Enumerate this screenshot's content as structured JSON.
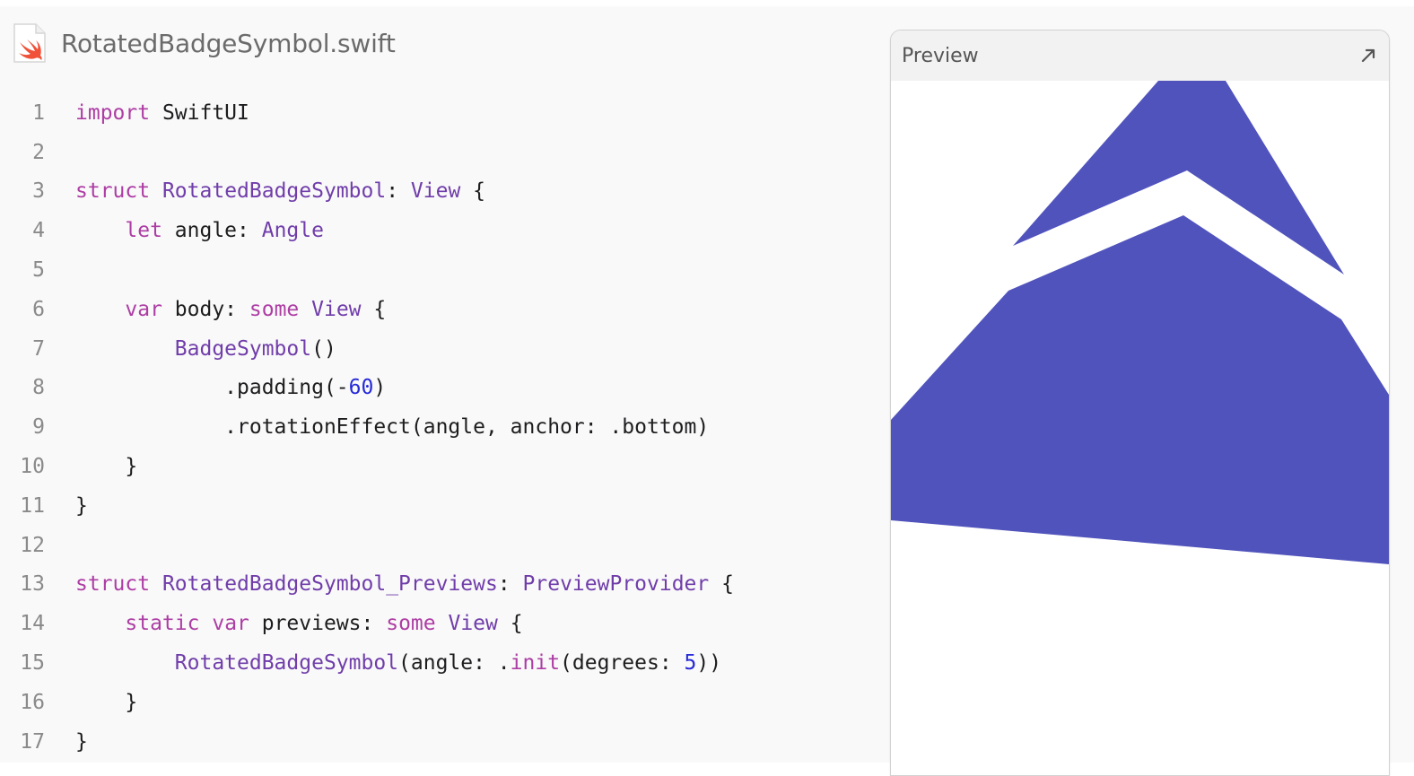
{
  "file": {
    "icon": "swift-file-icon",
    "title": "RotatedBadgeSymbol.swift"
  },
  "code": {
    "lines": [
      {
        "n": "1",
        "tokens": [
          {
            "t": "import",
            "c": "kw"
          },
          {
            "t": " SwiftUI",
            "c": "src"
          }
        ]
      },
      {
        "n": "2",
        "tokens": []
      },
      {
        "n": "3",
        "tokens": [
          {
            "t": "struct",
            "c": "kw"
          },
          {
            "t": " ",
            "c": "src"
          },
          {
            "t": "RotatedBadgeSymbol",
            "c": "ty"
          },
          {
            "t": ": ",
            "c": "src"
          },
          {
            "t": "View",
            "c": "ty"
          },
          {
            "t": " {",
            "c": "src"
          }
        ]
      },
      {
        "n": "4",
        "tokens": [
          {
            "t": "    ",
            "c": "src"
          },
          {
            "t": "let",
            "c": "kw"
          },
          {
            "t": " angle: ",
            "c": "src"
          },
          {
            "t": "Angle",
            "c": "ty"
          }
        ]
      },
      {
        "n": "5",
        "tokens": []
      },
      {
        "n": "6",
        "tokens": [
          {
            "t": "    ",
            "c": "src"
          },
          {
            "t": "var",
            "c": "kw"
          },
          {
            "t": " body: ",
            "c": "src"
          },
          {
            "t": "some",
            "c": "kw"
          },
          {
            "t": " ",
            "c": "src"
          },
          {
            "t": "View",
            "c": "ty"
          },
          {
            "t": " {",
            "c": "src"
          }
        ]
      },
      {
        "n": "7",
        "tokens": [
          {
            "t": "        ",
            "c": "src"
          },
          {
            "t": "BadgeSymbol",
            "c": "ty"
          },
          {
            "t": "()",
            "c": "src"
          }
        ]
      },
      {
        "n": "8",
        "tokens": [
          {
            "t": "            .padding(-",
            "c": "src"
          },
          {
            "t": "60",
            "c": "num"
          },
          {
            "t": ")",
            "c": "src"
          }
        ]
      },
      {
        "n": "9",
        "tokens": [
          {
            "t": "            .rotationEffect(angle, anchor: .bottom)",
            "c": "src"
          }
        ]
      },
      {
        "n": "10",
        "tokens": [
          {
            "t": "    }",
            "c": "src"
          }
        ]
      },
      {
        "n": "11",
        "tokens": [
          {
            "t": "}",
            "c": "src"
          }
        ]
      },
      {
        "n": "12",
        "tokens": []
      },
      {
        "n": "13",
        "tokens": [
          {
            "t": "struct",
            "c": "kw"
          },
          {
            "t": " ",
            "c": "src"
          },
          {
            "t": "RotatedBadgeSymbol_Previews",
            "c": "ty"
          },
          {
            "t": ": ",
            "c": "src"
          },
          {
            "t": "PreviewProvider",
            "c": "ty"
          },
          {
            "t": " {",
            "c": "src"
          }
        ]
      },
      {
        "n": "14",
        "tokens": [
          {
            "t": "    ",
            "c": "src"
          },
          {
            "t": "static",
            "c": "kw"
          },
          {
            "t": " ",
            "c": "src"
          },
          {
            "t": "var",
            "c": "kw"
          },
          {
            "t": " previews: ",
            "c": "src"
          },
          {
            "t": "some",
            "c": "kw"
          },
          {
            "t": " ",
            "c": "src"
          },
          {
            "t": "View",
            "c": "ty"
          },
          {
            "t": " {",
            "c": "src"
          }
        ]
      },
      {
        "n": "15",
        "tokens": [
          {
            "t": "        ",
            "c": "src"
          },
          {
            "t": "RotatedBadgeSymbol",
            "c": "ty"
          },
          {
            "t": "(angle: .",
            "c": "src"
          },
          {
            "t": "init",
            "c": "kw"
          },
          {
            "t": "(degrees: ",
            "c": "src"
          },
          {
            "t": "5",
            "c": "num"
          },
          {
            "t": "))",
            "c": "src"
          }
        ]
      },
      {
        "n": "16",
        "tokens": [
          {
            "t": "    }",
            "c": "src"
          }
        ]
      },
      {
        "n": "17",
        "tokens": [
          {
            "t": "}",
            "c": "src"
          }
        ]
      }
    ]
  },
  "preview": {
    "label": "Preview",
    "expand_icon": "expand-arrow-icon",
    "symbol_color": "#5053bc"
  },
  "colors": {
    "keyword": "#ad3da4",
    "type": "#703daa",
    "number": "#272ad8",
    "text": "#1d1d1f"
  }
}
